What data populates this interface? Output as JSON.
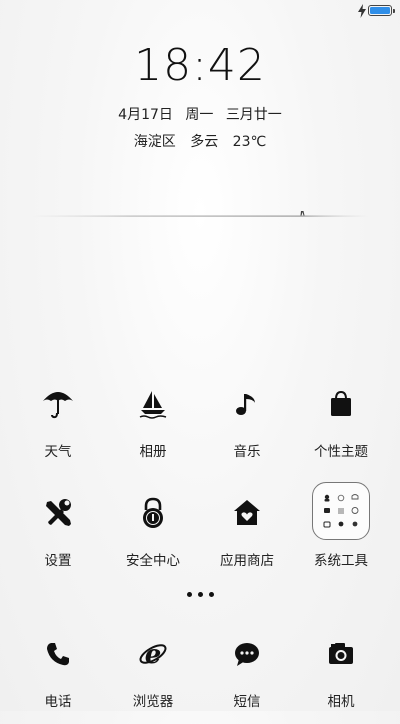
{
  "status_bar": {
    "charge_icon": "lightning-icon",
    "battery_level": 1.0,
    "battery_color": "#2f8ee8"
  },
  "lockscreen": {
    "time": "18:42",
    "date": {
      "day": "4月17日",
      "weekday": "周一",
      "lunar": "三月廿一"
    },
    "weather": {
      "location": "海淀区",
      "condition": "多云",
      "temperature": "23℃"
    }
  },
  "apps_row1": [
    {
      "label": "天气",
      "icon": "umbrella-icon"
    },
    {
      "label": "相册",
      "icon": "sailboat-icon"
    },
    {
      "label": "音乐",
      "icon": "music-note-icon"
    },
    {
      "label": "个性主题",
      "icon": "shopping-bag-icon"
    }
  ],
  "apps_row2": [
    {
      "label": "设置",
      "icon": "tools-icon"
    },
    {
      "label": "安全中心",
      "icon": "lock-icon"
    },
    {
      "label": "应用商店",
      "icon": "house-heart-icon"
    },
    {
      "label": "系统工具",
      "icon": "folder-icon"
    }
  ],
  "page_indicator": "more-dots",
  "dock": [
    {
      "label": "电话",
      "icon": "phone-icon"
    },
    {
      "label": "浏览器",
      "icon": "browser-e-icon"
    },
    {
      "label": "短信",
      "icon": "chat-bubble-icon"
    },
    {
      "label": "相机",
      "icon": "camera-icon"
    }
  ]
}
